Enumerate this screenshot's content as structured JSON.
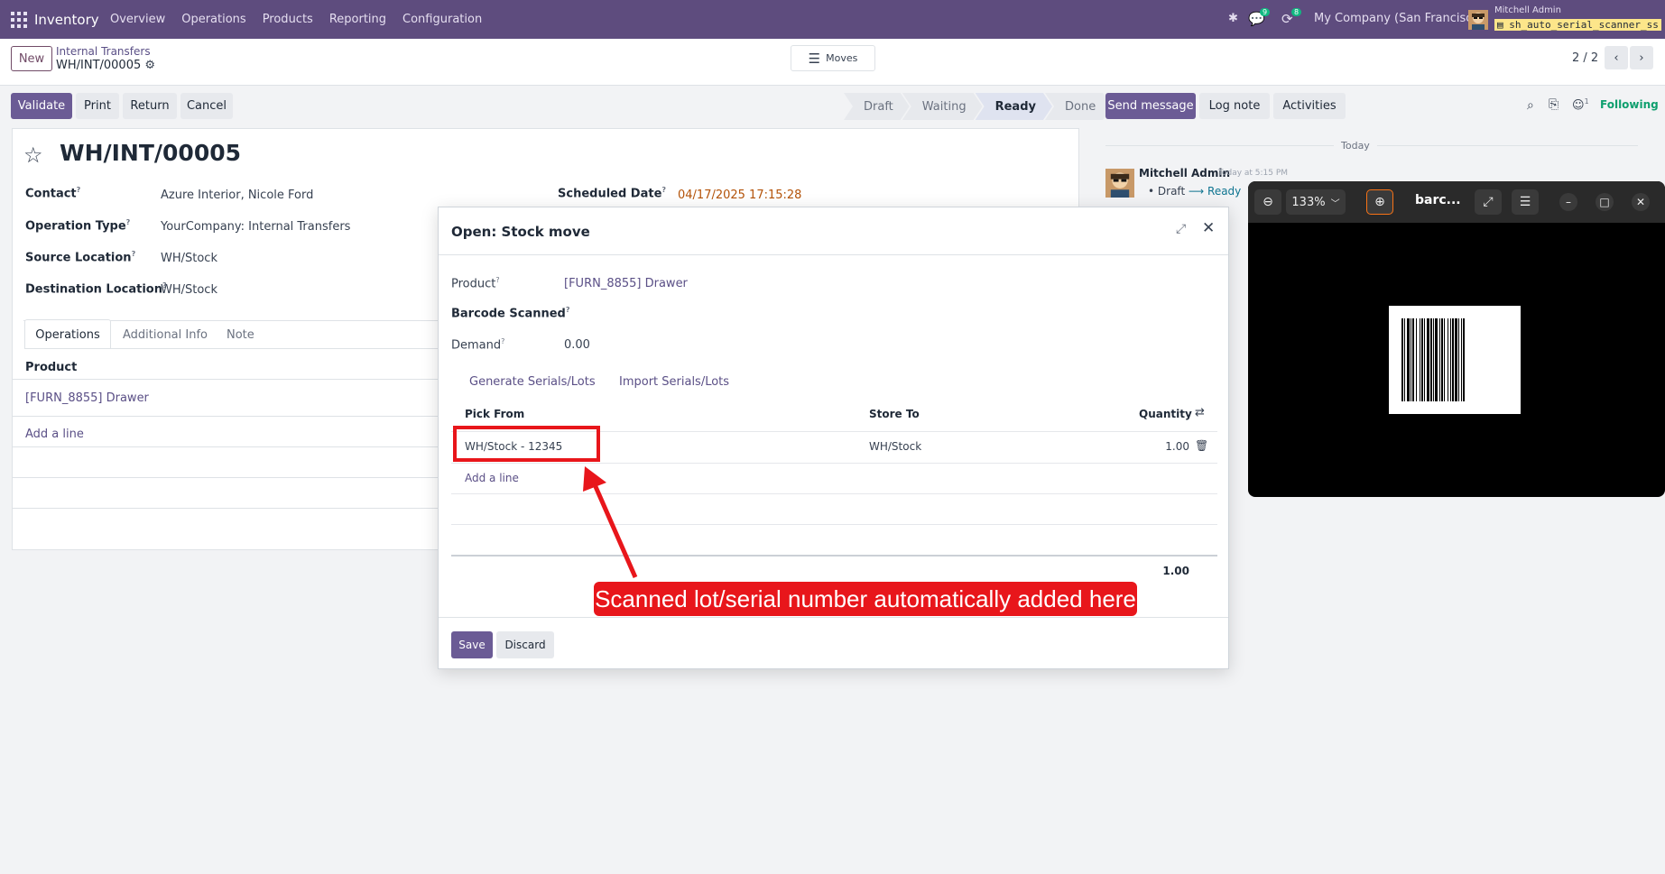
{
  "navbar": {
    "app_name": "Inventory",
    "menu": [
      "Overview",
      "Operations",
      "Products",
      "Reporting",
      "Configuration"
    ],
    "messages_count": "9",
    "activities_count": "8",
    "company": "My Company (San Francisco)",
    "user_name": "Mitchell Admin",
    "db_name": "sh_auto_serial_scanner_ss"
  },
  "control": {
    "new_label": "New",
    "breadcrumb_parent": "Internal Transfers",
    "breadcrumb_current": "WH/INT/00005",
    "moves_label": "Moves",
    "pager": "2 / 2"
  },
  "actions": {
    "validate": "Validate",
    "print": "Print",
    "return": "Return",
    "cancel": "Cancel",
    "stages": [
      "Draft",
      "Waiting",
      "Ready",
      "Done"
    ],
    "active_stage": "Ready"
  },
  "form": {
    "title": "WH/INT/00005",
    "contact_label": "Contact",
    "contact_value": "Azure Interior, Nicole Ford",
    "op_type_label": "Operation Type",
    "op_type_value": "YourCompany: Internal Transfers",
    "source_label": "Source Location",
    "source_value": "WH/Stock",
    "dest_label": "Destination Location",
    "dest_value": "WH/Stock",
    "scheduled_label": "Scheduled Date",
    "scheduled_value": "04/17/2025 17:15:28",
    "tabs": [
      "Operations",
      "Additional Info",
      "Note"
    ],
    "product_header": "Product",
    "product_row": "[FURN_8855] Drawer",
    "add_line": "Add a line"
  },
  "chatter": {
    "send_message": "Send message",
    "log_note": "Log note",
    "activities": "Activities",
    "followers_count": "1",
    "following": "Following",
    "today": "Today",
    "author": "Mitchell Admin",
    "time": "Today at 5:15 PM",
    "change_from": "Draft",
    "change_to": "Ready"
  },
  "modal": {
    "title": "Open: Stock move",
    "product_label": "Product",
    "product_value": "[FURN_8855] Drawer",
    "barcode_label": "Barcode Scanned",
    "demand_label": "Demand",
    "demand_value": "0.00",
    "generate_label": "Generate Serials/Lots",
    "import_label": "Import Serials/Lots",
    "col_pick": "Pick From",
    "col_store": "Store To",
    "col_qty": "Quantity",
    "rows": [
      {
        "pick": "WH/Stock - 12345",
        "store": "WH/Stock",
        "qty": "1.00"
      }
    ],
    "add_line": "Add a line",
    "total": "1.00",
    "save": "Save",
    "discard": "Discard"
  },
  "viewer": {
    "zoom": "133%",
    "title": "barc..."
  },
  "annotation": {
    "text": "Scanned lot/serial number automatically added here"
  },
  "colors": {
    "navbar": "#5e4c7e",
    "primary": "#6b5b95",
    "annotation_red": "#e8161b"
  }
}
